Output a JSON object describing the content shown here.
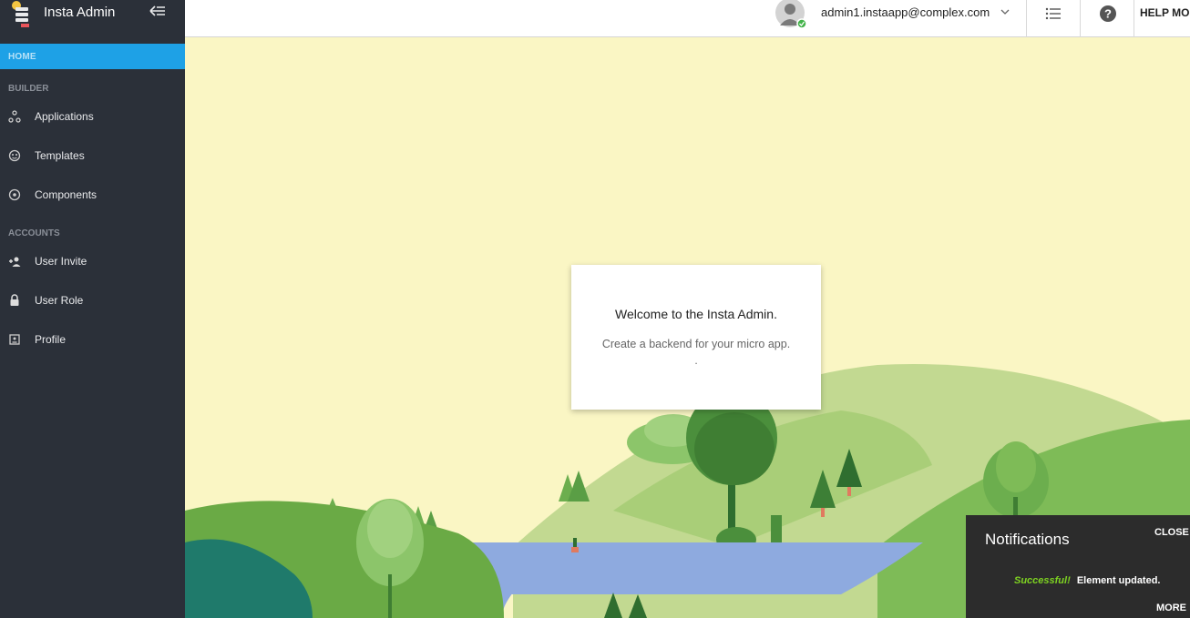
{
  "app": {
    "title": "Insta Admin"
  },
  "sidebar": {
    "home_label": "HOME",
    "sections": [
      {
        "title": "BUILDER",
        "items": [
          {
            "label": "Applications",
            "icon": "applications-icon"
          },
          {
            "label": "Templates",
            "icon": "templates-icon"
          },
          {
            "label": "Components",
            "icon": "components-icon"
          }
        ]
      },
      {
        "title": "ACCOUNTS",
        "items": [
          {
            "label": "User Invite",
            "icon": "user-invite-icon"
          },
          {
            "label": "User Role",
            "icon": "lock-icon"
          },
          {
            "label": "Profile",
            "icon": "profile-icon"
          }
        ]
      }
    ]
  },
  "header": {
    "user_email": "admin1.instaapp@complex.com",
    "help_label": "HELP MO"
  },
  "welcome": {
    "title": "Welcome to the Insta Admin.",
    "subtitle": "Create a backend for your micro app.",
    "dot": "."
  },
  "notifications": {
    "title": "Notifications",
    "close_label": "CLOSE",
    "status": "Successful!",
    "message": "Element updated.",
    "more_label": "MORE"
  },
  "colors": {
    "sidebar_bg": "#2b3039",
    "accent": "#1ea1e6",
    "background": "#faf6c4",
    "success": "#7ed321"
  }
}
